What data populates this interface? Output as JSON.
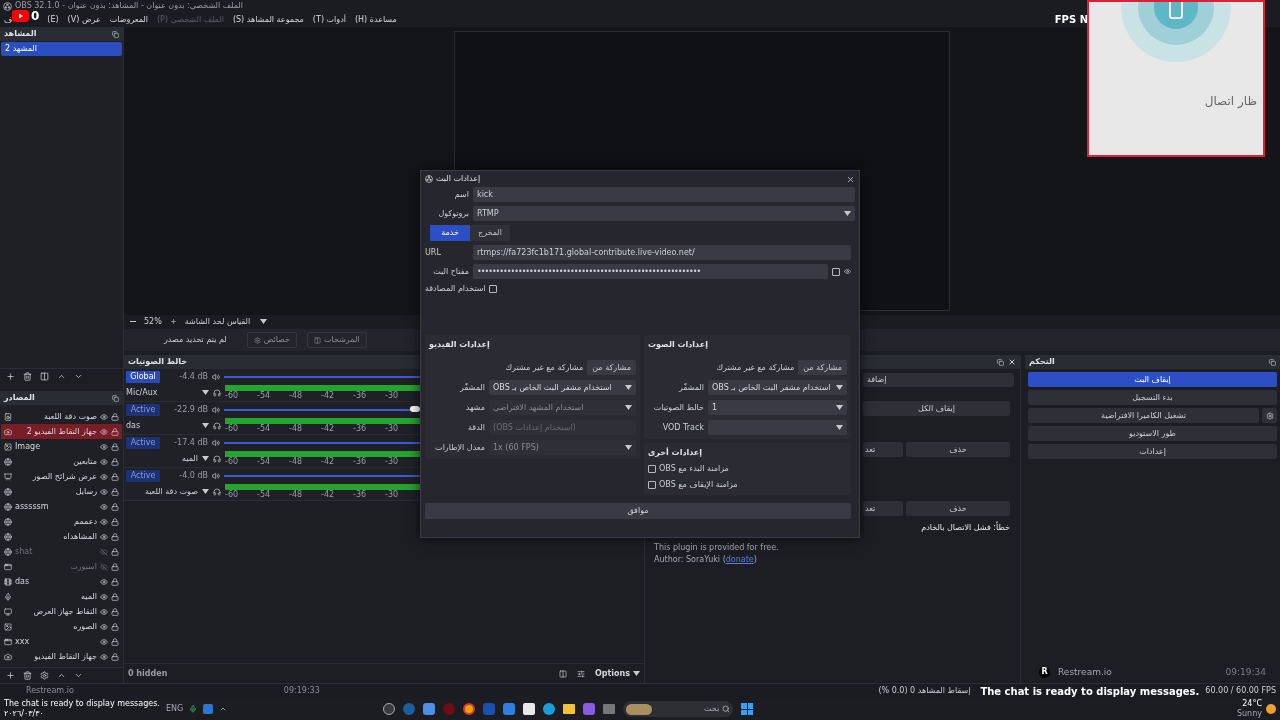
{
  "title_bar": {
    "title": "الملف الشخصي: بدون عنوان - المشاهد: بدون عنوان - OBS 32.1.0"
  },
  "menu": {
    "badge": "0",
    "overlay_text": "FPS N",
    "items": [
      {
        "label": "مساعدة (H)",
        "disabled": false
      },
      {
        "label": "أدوات (T)",
        "disabled": false
      },
      {
        "label": "مجموعة المشاهد (S)",
        "disabled": false
      },
      {
        "label": "الملف الشخصي (P)",
        "disabled": true
      },
      {
        "label": "المعروضات",
        "disabled": false
      },
      {
        "label": "عرض (V)",
        "disabled": false
      },
      {
        "label": "(E)",
        "disabled": false
      },
      {
        "label": "ف",
        "disabled": false
      }
    ]
  },
  "scenes": {
    "header": "المشاهد",
    "items": [
      {
        "name": "المشهد 2",
        "selected": true
      }
    ]
  },
  "sources": {
    "header": "المصادر",
    "items": [
      {
        "name": "صوت دقة اللعبة",
        "kind": "audio",
        "visible": true,
        "selected": false
      },
      {
        "name": "جهاز التقاط الفيديو 2",
        "kind": "camera",
        "visible": true,
        "selected": true
      },
      {
        "name": "Image",
        "kind": "image",
        "visible": true,
        "selected": false
      },
      {
        "name": "متابعين",
        "kind": "browser",
        "visible": true,
        "selected": false
      },
      {
        "name": "عرض شرائح الصور",
        "kind": "slideshow",
        "visible": true,
        "selected": false
      },
      {
        "name": "رسايل",
        "kind": "browser",
        "visible": true,
        "selected": false
      },
      {
        "name": "asssssm",
        "kind": "browser",
        "visible": true,
        "selected": false
      },
      {
        "name": "دعممم",
        "kind": "browser",
        "visible": true,
        "selected": false
      },
      {
        "name": "المشاهداه",
        "kind": "browser",
        "visible": true,
        "selected": false
      },
      {
        "name": "shat",
        "kind": "browser",
        "visible": false,
        "selected": false
      },
      {
        "name": "اسبورت",
        "kind": "window",
        "visible": false,
        "selected": false
      },
      {
        "name": "das",
        "kind": "media",
        "visible": true,
        "selected": false
      },
      {
        "name": "الميه",
        "kind": "mic",
        "visible": true,
        "selected": false
      },
      {
        "name": "التقاط جهاز العرض",
        "kind": "display",
        "visible": true,
        "selected": false
      },
      {
        "name": "الصوره",
        "kind": "image",
        "visible": true,
        "selected": false
      },
      {
        "name": "xxx",
        "kind": "window",
        "visible": true,
        "selected": false
      },
      {
        "name": "جهاز التقاط الفيديو",
        "kind": "camera",
        "visible": true,
        "selected": false
      }
    ]
  },
  "preview_bar": {
    "zoom": "52%",
    "scale_mode": "القياس لحد الشاشة"
  },
  "source_toolbar": {
    "status": "لم يتم تحديد مصدر",
    "properties": "خصائص",
    "filters": "المرشحات"
  },
  "mixer": {
    "header": "خالط الصوتيات",
    "hidden_label": "0 hidden",
    "options": "Options",
    "channels": [
      {
        "badge": "Global",
        "highlighted": true,
        "reading": "-4.4 dB",
        "name": "Mic/Aux",
        "level": 0.62,
        "ticks": [
          "-30",
          "-36",
          "-42",
          "-48",
          "-54",
          "-60"
        ]
      },
      {
        "badge": "Active",
        "highlighted": false,
        "reading": "-22.9 dB",
        "name": "das",
        "level": 0.45,
        "ticks": [
          "-30",
          "-36",
          "-42",
          "-48",
          "-54",
          "-60"
        ]
      },
      {
        "badge": "Active",
        "highlighted": false,
        "reading": "-17.4 dB",
        "name": "الميه",
        "level": 0.52,
        "ticks": [
          "-30",
          "-36",
          "-42",
          "-48",
          "-54",
          "-60"
        ]
      },
      {
        "badge": "Active",
        "highlighted": false,
        "reading": "-4.0 dB",
        "name": "صوت دقة اللعبة",
        "level": 0.62,
        "ticks": [
          "-30",
          "-36",
          "-42",
          "-48",
          "-54",
          "-60"
        ]
      }
    ]
  },
  "dock": {
    "add_button": "إضافة",
    "stop_all": "إيقاف الكل",
    "row_a": [
      "حذف",
      "تعد"
    ],
    "row_b": [
      "حذف",
      "تعد"
    ],
    "error": "خطأ: فشل الاتصال بالخادم",
    "plugin_note": "This plugin is provided for free.",
    "author_prefix": "Author: SoraYuki (",
    "author_link": "donate",
    "author_suffix": ")"
  },
  "controls": {
    "header": "التحكم",
    "buttons": [
      {
        "label": "إيقاف البث",
        "active": true,
        "gear": false
      },
      {
        "label": "بدء التسجيل",
        "active": false,
        "gear": false
      },
      {
        "label": "تشغيل الكاميرا الافتراضية",
        "active": false,
        "gear": true
      },
      {
        "label": "طور الاستوديو",
        "active": false,
        "gear": false
      },
      {
        "label": "إعدادات",
        "active": false,
        "gear": false
      }
    ]
  },
  "dialog": {
    "title": "إعدادات البث",
    "name_label": "اسم",
    "name_value": "kick",
    "protocol_label": "بروتوكول",
    "protocol_value": "RTMP",
    "tabs": [
      {
        "label": "المخرج",
        "selected": false
      },
      {
        "label": "خدمة",
        "selected": true
      }
    ],
    "url_label": "URL",
    "url_value": "rtmps://fa723fc1b171.global-contribute.live-video.net/",
    "key_label": "مفتاح البث",
    "key_value": "••••••••••••••••••••••••••••••••••••••••••••••••••••••••••••",
    "show_key": false,
    "auth_label": "استخدام المصادقة",
    "auth_checked": false,
    "video": {
      "title": "إعدادات الفيديو",
      "share_text": "مشاركة مع غير مشترك",
      "share_button": "مشاركة من",
      "fields": [
        {
          "label": "المشفّر",
          "value": "استخدام مشفر البث الخاص بـ OBS",
          "disabled": false,
          "kind": "select"
        },
        {
          "label": "مشهد",
          "value": "استخدام المشهد الافتراضي",
          "disabled": true,
          "kind": "select"
        },
        {
          "label": "الدقة",
          "placeholder": "(استخدام إعدادات OBS)",
          "disabled": true,
          "kind": "text"
        },
        {
          "label": "معدل الإطارات",
          "value": "1x (60 FPS)",
          "disabled": true,
          "kind": "select"
        }
      ]
    },
    "audio": {
      "title": "إعدادات الصوت",
      "share_text": "مشاركة مع غير مشترك",
      "share_button": "مشاركة من",
      "fields": [
        {
          "label": "المشفّر",
          "value": "استخدام مشفر البث الخاص بـ OBS",
          "disabled": false,
          "kind": "select"
        },
        {
          "label": "خالط الصوتيات",
          "value": "1",
          "disabled": false,
          "kind": "select"
        },
        {
          "label": "VOD Track",
          "disabled": false,
          "kind": "select"
        }
      ]
    },
    "other": {
      "title": "إعدادات أخرى",
      "checks": [
        {
          "label": "مزامنة البدء مع OBS",
          "checked": false
        },
        {
          "label": "مزامنة الإيقاف مع OBS",
          "checked": false
        }
      ]
    },
    "ok": "موافق"
  },
  "status_bar": {
    "dropped": "إسقاط المشاهد 0 (0.0 %)",
    "fps": "60.00 / 60.00 FPS"
  },
  "overlays": {
    "connect_card": "ظار اتصال",
    "chat_notice": "The chat is ready to display messages.",
    "restream_logo": "R",
    "restream_name": "Restream.io",
    "restream_time": "09:19:34",
    "faint_name": "Restream.io",
    "faint_time": "09:19:33",
    "taskbar_chat": "The chat is ready to display messages."
  },
  "taskbar": {
    "date": "٢٠٢٦/٠٣/٣٠",
    "lang": "ENG",
    "search_placeholder": "بحث",
    "temperature": "24°C",
    "weather": "Sunny"
  }
}
